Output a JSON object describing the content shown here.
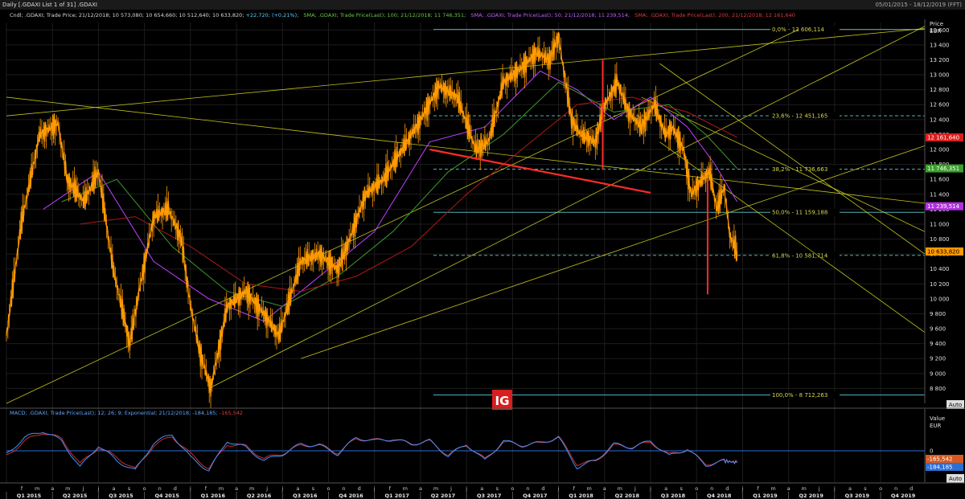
{
  "window": {
    "title": "Daily [.GDAXI List 1 of 31] .GDAXI",
    "range": "05/01/2015 - 18/12/2019 (FFT)"
  },
  "legend": {
    "cndl": "Cndl; .GDAXI; Trade Price; 21/12/2018; 10 573,080; 10 654,660; 10 512,640; 10 633,820; ",
    "cndl_change": "+22,720; (+0,21%);",
    "sma100": "SMA; .GDAXI; Trade Price(Last); 100; 21/12/2018; 11 746,351;",
    "sma50": "SMA; .GDAXI; Trade Price(Last); 50; 21/12/2018; 11 239,514;",
    "sma200": "SMA; .GDAXI; Trade Price(Last); 200; 21/12/2018; 12 161,640",
    "macd": "MACD; .GDAXI; Trade Price(Last); 12; 26; 9; Exponential; 21/12/2018; ",
    "macd_v1": "-184,185;",
    "macd_v2": " -165,542"
  },
  "logo_text": "IG",
  "colors": {
    "background": "#000000",
    "price": "#ff9a00",
    "sma50": "#c040ff",
    "sma100": "#3c9a2a",
    "sma200": "#b01818",
    "trendline": "#d8d820",
    "neckline": "#ff2a2a",
    "fib_solid": "#5fc9d8",
    "fib_dashed": "#5fc9d8",
    "macd": "#4a90ff",
    "signal": "#c83030",
    "zero_line": "#2a6fd6",
    "logo_bg": "#d81e1e"
  },
  "chart_data": {
    "type": "line",
    "title": "Daily [.GDAXI List 1 of 31] .GDAXI",
    "price_axis": {
      "label": "Price",
      "unit": "EUR",
      "ylim": [
        8600,
        13700
      ],
      "ticks": [
        8800,
        9000,
        9200,
        9400,
        9600,
        9800,
        10000,
        10200,
        10400,
        10600,
        10800,
        11000,
        11200,
        11400,
        11600,
        11800,
        12000,
        12200,
        12400,
        12600,
        12800,
        13000,
        13200,
        13400,
        13600
      ],
      "tick_labels": [
        "8 800",
        "9 000",
        "9 200",
        "9 400",
        "9 600",
        "9 800",
        "10 000",
        "10 200",
        "10 400",
        "10 600",
        "10 800",
        "11 000",
        "11 200",
        "11 400",
        "11 600",
        "11 800",
        "12 000",
        "12 200",
        "12 400",
        "12 600",
        "12 800",
        "13 000",
        "13 200",
        "13 400",
        "13 600"
      ]
    },
    "time_axis": {
      "xlim": [
        2015.0,
        2019.99
      ],
      "month_letters": [
        "f",
        "m",
        "a",
        "m",
        "j",
        "j",
        "a",
        "s",
        "o",
        "n",
        "d",
        "j",
        "f",
        "m",
        "a",
        "m",
        "j",
        "j",
        "a",
        "s",
        "o",
        "n",
        "d",
        "j",
        "f",
        "m",
        "a",
        "m",
        "j",
        "j",
        "a",
        "s",
        "o",
        "n",
        "d",
        "j",
        "f",
        "m",
        "a",
        "m",
        "j",
        "j",
        "a",
        "s",
        "o",
        "n",
        "d",
        "j",
        "f",
        "m",
        "a",
        "m",
        "j",
        "j",
        "a",
        "s",
        "o",
        "n",
        "d",
        "j",
        "f",
        "m",
        "a",
        "m",
        "j",
        "j",
        "a",
        "s",
        "o",
        "n",
        "d",
        "j",
        "f",
        "m",
        "a",
        "m",
        "j",
        "j",
        "a",
        "s",
        "o",
        "n",
        "d",
        "j",
        "f",
        "m",
        "a",
        "m",
        "j",
        "j",
        "a",
        "s",
        "o",
        "n",
        "d"
      ],
      "quarters": [
        "Q1 2015",
        "Q2 2015",
        "Q3 2015",
        "Q4 2015",
        "Q1 2016",
        "Q2 2016",
        "Q3 2016",
        "Q4 2016",
        "Q1 2017",
        "Q2 2017",
        "Q3 2017",
        "Q4 2017",
        "Q1 2018",
        "Q2 2018",
        "Q3 2018",
        "Q4 2018",
        "Q1 2019",
        "Q2 2019",
        "Q3 2019",
        "Q4 2019"
      ]
    },
    "price_series": {
      "name": "Cndl",
      "x": [
        2015.0,
        2015.08,
        2015.18,
        2015.28,
        2015.33,
        2015.42,
        2015.5,
        2015.58,
        2015.67,
        2015.72,
        2015.8,
        2015.88,
        2015.95,
        2016.0,
        2016.05,
        2016.11,
        2016.2,
        2016.3,
        2016.4,
        2016.48,
        2016.6,
        2016.7,
        2016.8,
        2016.85,
        2016.95,
        2017.05,
        2017.15,
        2017.25,
        2017.35,
        2017.45,
        2017.55,
        2017.62,
        2017.7,
        2017.8,
        2017.88,
        2017.95,
        2018.0,
        2018.07,
        2018.12,
        2018.2,
        2018.25,
        2018.32,
        2018.38,
        2018.45,
        2018.52,
        2018.58,
        2018.62,
        2018.68,
        2018.72,
        2018.78,
        2018.82,
        2018.86,
        2018.9,
        2018.93,
        2018.97
      ],
      "values": [
        9500,
        11000,
        12200,
        12350,
        11600,
        11300,
        11700,
        10400,
        9400,
        10100,
        11100,
        11200,
        10800,
        9900,
        9300,
        8800,
        9900,
        10100,
        9800,
        9500,
        10500,
        10600,
        10400,
        10700,
        11400,
        11600,
        12000,
        12400,
        12850,
        12700,
        12000,
        12100,
        12900,
        13100,
        13300,
        13200,
        13500,
        12400,
        12200,
        12100,
        12600,
        12900,
        12500,
        12300,
        12600,
        12200,
        12300,
        12000,
        11400,
        11600,
        11700,
        11200,
        11500,
        10850,
        10634
      ]
    },
    "sma_series": [
      {
        "name": "SMA 50",
        "color": "#c040ff",
        "x": [
          2015.2,
          2015.5,
          2015.8,
          2016.1,
          2016.4,
          2016.7,
          2017.0,
          2017.3,
          2017.6,
          2017.9,
          2018.1,
          2018.3,
          2018.5,
          2018.7,
          2018.85,
          2018.97
        ],
        "values": [
          11200,
          11700,
          10500,
          10000,
          9700,
          10300,
          10900,
          12100,
          12300,
          13050,
          12800,
          12400,
          12700,
          12300,
          11800,
          11300
        ]
      },
      {
        "name": "SMA 100",
        "color": "#3c9a2a",
        "x": [
          2015.3,
          2015.6,
          2015.9,
          2016.2,
          2016.5,
          2016.8,
          2017.1,
          2017.4,
          2017.7,
          2018.0,
          2018.3,
          2018.6,
          2018.8,
          2018.97
        ],
        "values": [
          11300,
          11600,
          10700,
          10100,
          9900,
          10300,
          10900,
          11700,
          12200,
          12900,
          12500,
          12600,
          12200,
          11746
        ]
      },
      {
        "name": "SMA 200",
        "color": "#b01818",
        "x": [
          2015.4,
          2015.7,
          2016.0,
          2016.3,
          2016.6,
          2016.9,
          2017.2,
          2017.5,
          2017.8,
          2018.1,
          2018.4,
          2018.7,
          2018.97
        ],
        "values": [
          11000,
          11100,
          10700,
          10200,
          10100,
          10300,
          10700,
          11400,
          12000,
          12600,
          12700,
          12500,
          12162
        ]
      }
    ],
    "fibonacci": [
      {
        "label": "0,0% - 13 606,114",
        "value": 13606.114,
        "style": "solid"
      },
      {
        "label": "23,6% - 12 451,165",
        "value": 12451.165,
        "style": "dashed"
      },
      {
        "label": "38,2% - 11 736,663",
        "value": 11736.663,
        "style": "dashed"
      },
      {
        "label": "50,0% - 11 159,188",
        "value": 11159.188,
        "style": "solid"
      },
      {
        "label": "61,8% - 10 581,714",
        "value": 10581.714,
        "style": "dashed"
      },
      {
        "label": "100,0% - 8 712,263",
        "value": 8712.263,
        "style": "solid"
      }
    ],
    "trendlines": [
      {
        "x": [
          2015.0,
          2019.99
        ],
        "values": [
          12450,
          13620
        ]
      },
      {
        "x": [
          2015.0,
          2019.99
        ],
        "values": [
          12700,
          11280
        ]
      },
      {
        "x": [
          2015.0,
          2019.3
        ],
        "values": [
          8600,
          13600
        ]
      },
      {
        "x": [
          2016.1,
          2019.99
        ],
        "values": [
          8800,
          13650
        ]
      },
      {
        "x": [
          2016.6,
          2019.99
        ],
        "values": [
          9200,
          12050
        ]
      },
      {
        "x": [
          2018.55,
          2019.99
        ],
        "values": [
          13150,
          10600
        ]
      },
      {
        "x": [
          2018.55,
          2019.99
        ],
        "values": [
          12100,
          9550
        ]
      },
      {
        "x": [
          2018.45,
          2019.99
        ],
        "values": [
          12700,
          10900
        ]
      }
    ],
    "neckline": {
      "x": [
        2017.3,
        2018.5
      ],
      "values": [
        12000,
        11420
      ]
    },
    "measure_lines": [
      {
        "x": 2018.24,
        "from": 13200,
        "to": 11730
      },
      {
        "x": 2018.81,
        "from": 11600,
        "to": 10060
      }
    ],
    "price_tags": [
      {
        "text": "12 161,640",
        "value": 12161.64,
        "color": "#d81e1e"
      },
      {
        "text": "11 746,351",
        "value": 11746.351,
        "color": "#3aa02a"
      },
      {
        "text": "11 239,514",
        "value": 11239.514,
        "color": "#b030e0"
      },
      {
        "text": "10 633,820",
        "value": 10633.82,
        "color": "#ff9a00"
      }
    ],
    "macd_panel": {
      "axis_label": "Value",
      "unit": "EUR",
      "zero_label": "0",
      "ylim": [
        -450,
        450
      ],
      "x": [
        2015.0,
        2015.1,
        2015.2,
        2015.3,
        2015.4,
        2015.5,
        2015.6,
        2015.7,
        2015.8,
        2015.9,
        2016.0,
        2016.1,
        2016.2,
        2016.3,
        2016.4,
        2016.5,
        2016.6,
        2016.7,
        2016.8,
        2016.9,
        2017.0,
        2017.1,
        2017.2,
        2017.3,
        2017.4,
        2017.5,
        2017.6,
        2017.7,
        2017.8,
        2017.9,
        2018.0,
        2018.1,
        2018.2,
        2018.3,
        2018.4,
        2018.5,
        2018.6,
        2018.7,
        2018.8,
        2018.9,
        2018.97
      ],
      "macd": [
        -50,
        200,
        300,
        150,
        -250,
        80,
        -150,
        -300,
        120,
        250,
        -100,
        -300,
        150,
        50,
        -150,
        -50,
        100,
        80,
        -50,
        200,
        150,
        180,
        100,
        150,
        -80,
        100,
        -150,
        150,
        80,
        120,
        200,
        -250,
        -150,
        100,
        50,
        150,
        -80,
        30,
        -220,
        -150,
        -184
      ],
      "signal": [
        -80,
        150,
        280,
        180,
        -200,
        50,
        -100,
        -280,
        80,
        220,
        -50,
        -270,
        100,
        70,
        -120,
        -40,
        80,
        90,
        -30,
        180,
        160,
        170,
        110,
        140,
        -60,
        90,
        -130,
        130,
        90,
        110,
        210,
        -200,
        -160,
        80,
        60,
        130,
        -60,
        20,
        -200,
        -160,
        -166
      ],
      "value_tags": [
        {
          "text": "-165,542",
          "color": "#d85a20"
        },
        {
          "text": "-184,185",
          "color": "#2a6fd6"
        }
      ],
      "auto_label": "Auto"
    },
    "top_auto_label": "Auto"
  }
}
